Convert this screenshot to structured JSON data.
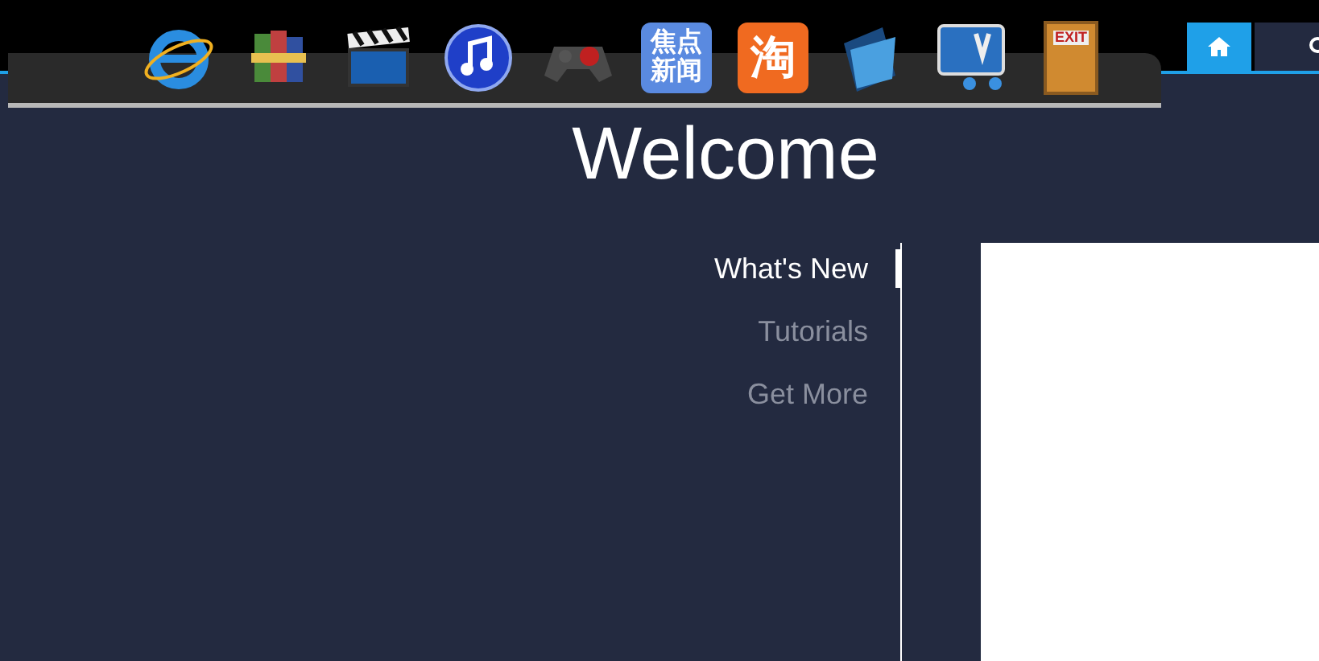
{
  "dock": {
    "items": [
      {
        "kind": "browser"
      },
      {
        "kind": "archive"
      },
      {
        "kind": "video"
      },
      {
        "kind": "music"
      },
      {
        "kind": "game"
      },
      {
        "kind": "news",
        "glyph": "焦点新闻"
      },
      {
        "kind": "shop",
        "glyph": "淘"
      },
      {
        "kind": "folder"
      },
      {
        "kind": "screen"
      },
      {
        "kind": "exit",
        "glyph": "EXIT"
      }
    ]
  },
  "tabs": [
    {
      "kind": "home",
      "selected": true
    },
    {
      "kind": "search",
      "selected": false
    }
  ],
  "title": "Welcome",
  "nav": [
    {
      "label": "What's New",
      "selected": true
    },
    {
      "label": "Tutorials",
      "selected": false
    },
    {
      "label": "Get More",
      "selected": false
    }
  ]
}
